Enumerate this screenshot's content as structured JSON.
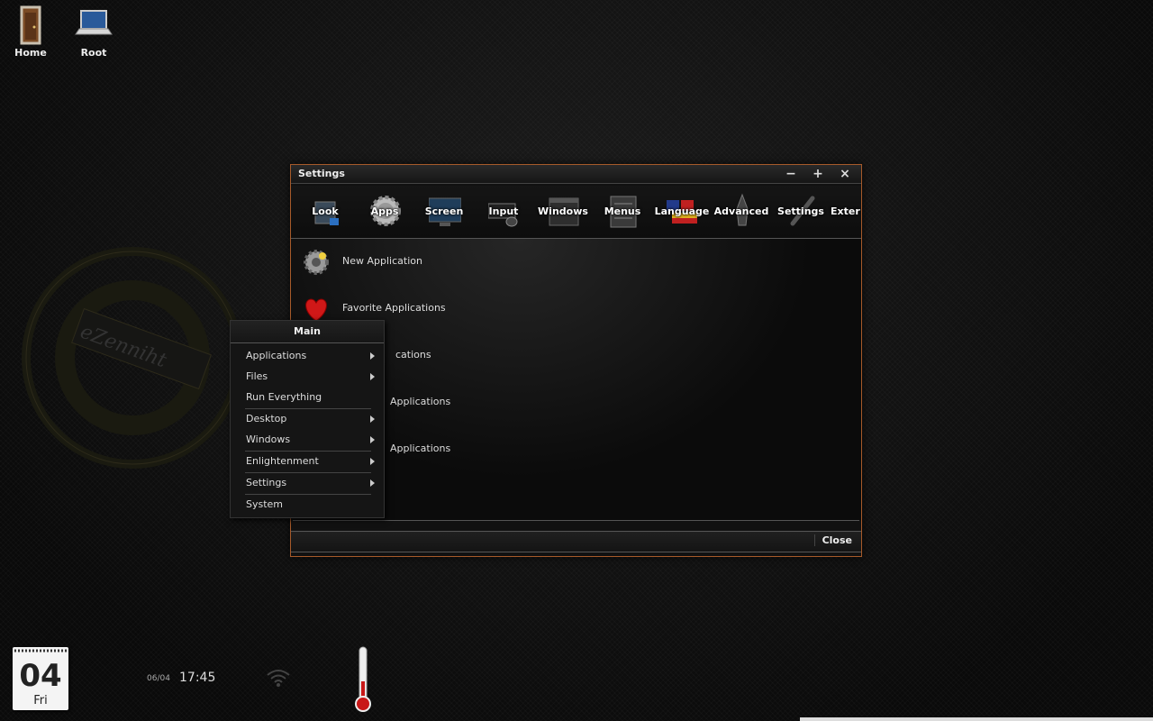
{
  "desktop": {
    "icons": [
      {
        "label": "Home"
      },
      {
        "label": "Root"
      }
    ],
    "watermark_text": "eZenniht"
  },
  "settings_window": {
    "title": "Settings",
    "controls": {
      "minimize": "−",
      "maximize": "+",
      "close": "×"
    },
    "toolbar": [
      {
        "label": "Look",
        "icon": "look-icon"
      },
      {
        "label": "Apps",
        "icon": "gear-icon"
      },
      {
        "label": "Screen",
        "icon": "monitor-icon"
      },
      {
        "label": "Input",
        "icon": "keyboard-icon"
      },
      {
        "label": "Windows",
        "icon": "window-icon"
      },
      {
        "label": "Menus",
        "icon": "menu-icon"
      },
      {
        "label": "Language",
        "icon": "flag-icon"
      },
      {
        "label": "Advanced",
        "icon": "rocket-icon"
      },
      {
        "label": "Settings",
        "icon": "wrench-icon"
      },
      {
        "label": "Exter",
        "icon": "extension-icon"
      }
    ],
    "items": [
      {
        "label": "New Application",
        "icon": "gear-star-icon"
      },
      {
        "label": "Favorite Applications",
        "icon": "heart-icon"
      },
      {
        "label": "cations"
      },
      {
        "label": "Applications"
      },
      {
        "label": "Applications"
      }
    ],
    "footer": {
      "close_label": "Close"
    }
  },
  "main_menu": {
    "title": "Main",
    "items": [
      {
        "label": "Applications",
        "submenu": true
      },
      {
        "label": "Files",
        "submenu": true
      },
      {
        "label": "Run Everything",
        "submenu": false
      },
      {
        "label": "Desktop",
        "submenu": true
      },
      {
        "label": "Windows",
        "submenu": true
      },
      {
        "label": "Enlightenment",
        "submenu": true
      },
      {
        "label": "Settings",
        "submenu": true
      },
      {
        "label": "System",
        "submenu": false
      }
    ]
  },
  "shelf": {
    "calendar": {
      "day": "04",
      "weekday": "Fri"
    },
    "clock": {
      "date": "06/04",
      "time": "17:45"
    }
  }
}
